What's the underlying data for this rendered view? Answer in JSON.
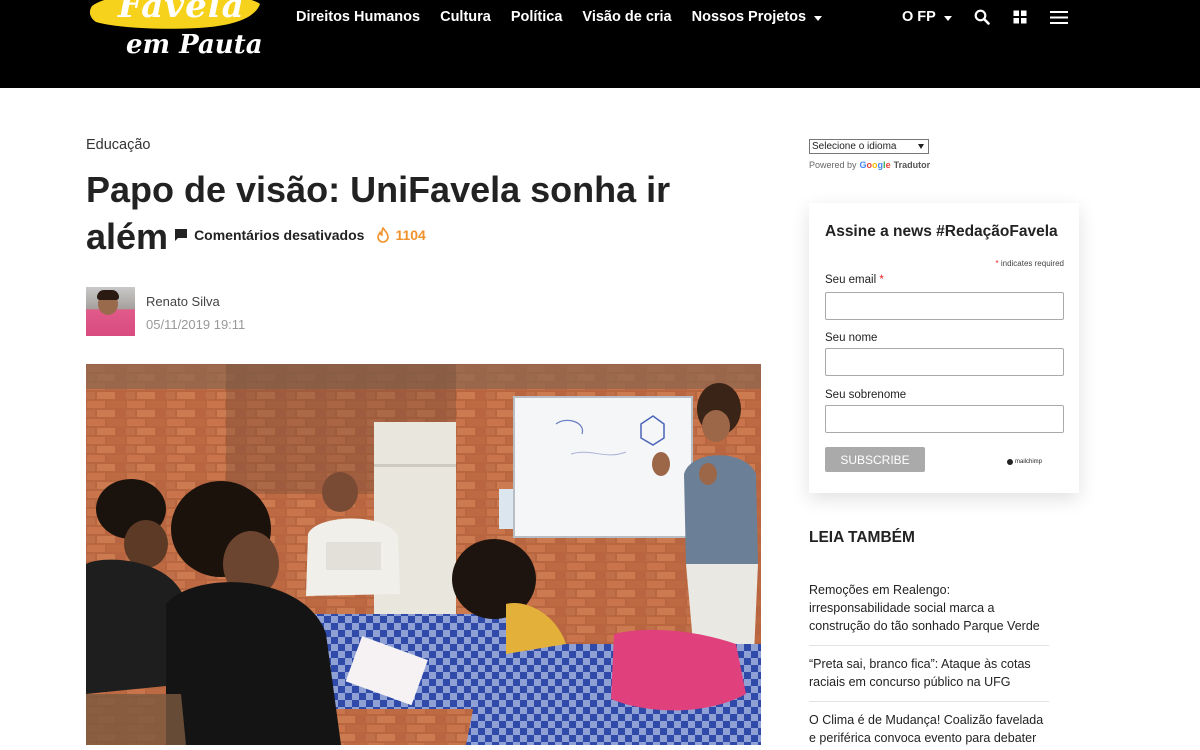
{
  "header": {
    "logo_line1": "Favela",
    "logo_line2": "em Pauta",
    "nav": [
      "Direitos Humanos",
      "Cultura",
      "Política",
      "Visão de cria",
      "Nossos Projetos"
    ],
    "ofp_label": "O FP",
    "icons": [
      "search-icon",
      "grid-icon",
      "menu-icon"
    ],
    "colors": {
      "bar": "#000000",
      "logo_swash": "#f6d21d"
    }
  },
  "article": {
    "category": "Educação",
    "title": "Papo de visão: UniFavela sonha ir além",
    "comments": "Comentários desativados",
    "views": "1104",
    "author": "Renato Silva",
    "date": "05/11/2019 19:11",
    "accent_color": "#f0922c"
  },
  "sidebar": {
    "language_select": "Selecione o idioma",
    "powered_by": "Powered by",
    "google": "Google",
    "translator": "Tradutor",
    "newsletter": {
      "title": "Assine a news #RedaçãoFavela",
      "required_note": "indicates required",
      "email_label": "Seu email",
      "name_label": "Seu nome",
      "surname_label": "Seu sobrenome",
      "button": "SUBSCRIBE",
      "badge": "mailchimp"
    },
    "leia_tambem": {
      "title": "LEIA TAMBÉM",
      "items": [
        "Remoções em Realengo: irresponsabilidade social marca a construção do tão sonhado Parque Verde",
        "“Preta sai, branco fica”: Ataque às cotas raciais em concurso público na UFG",
        "O Clima é de Mudança! Coalizão favelada e periférica convoca evento para debater"
      ]
    }
  }
}
